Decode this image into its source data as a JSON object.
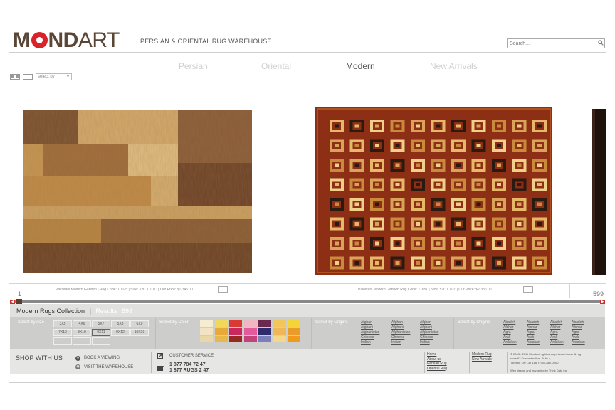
{
  "header": {
    "logo_bold": "MOND",
    "logo_light": "ART",
    "tagline": "PERSIAN & ORIENTAL RUG WAREHOUSE",
    "search_placeholder": "Search..."
  },
  "nav": [
    {
      "label": "Persian",
      "active": false
    },
    {
      "label": "Oriental",
      "active": false
    },
    {
      "label": "Modern",
      "active": true
    },
    {
      "label": "New Arrivals",
      "active": false
    }
  ],
  "select_by": "select by",
  "rugs": [
    {
      "caption": "Pakistani Modern Gabbeh  |  Rug Code: 10025  |  Size: 5'8\" X 7'11\"  |  Our Price: $1,345.00"
    },
    {
      "caption": "Pakistani Modern Gabbeh Rug Code: 11651  |  Size: 5'8\" X 8'0\"  |  Our Price: $2,380.00"
    }
  ],
  "pager": {
    "first": "1",
    "last": "599"
  },
  "collection": {
    "title": "Modern Rugs Collection",
    "results_label": "Results",
    "results_count": "599"
  },
  "filters": {
    "size_label": "Select by size",
    "sizes": [
      "3X5",
      "4X6",
      "5X7",
      "5X8",
      "6X9",
      "7X10",
      "8X10",
      "9X11",
      "9X12",
      "10X19"
    ],
    "selected_size": "9X11",
    "color_label": "Select by Color",
    "colors": [
      [
        "#f5ecd2",
        "#f0d85a",
        "#d93a34",
        "#f0b7c3",
        "#6b2950",
        "#f3c65a",
        "#f3d53a"
      ],
      [
        "#f2e4c2",
        "#e8a93a",
        "#c8285e",
        "#e45b9b",
        "#2d2c6a",
        "#f0b65a",
        "#ea9c2a"
      ],
      [
        "#e9d7a8",
        "#e8b84a",
        "#962a23",
        "#c2437a",
        "#7a7fba",
        "#f3d78a",
        "#f29a1e"
      ]
    ],
    "origins_label": "Select by Origins",
    "origins_col": [
      "Afghan",
      "Afghani",
      "Afghanistan",
      "Chinese",
      "Indian"
    ],
    "origins2_label": "Select by Origins",
    "origins2_col": [
      "Abadeh",
      "Afshar",
      "Agra",
      "Arak",
      "Ardakan"
    ]
  },
  "footer": {
    "shop_title": "SHOP WITH US",
    "book": "BOOK A VIEWING",
    "visit": "VISIT THE WAREHOUSE",
    "service": "CUSTOMER SERVICE",
    "phone1": "1 877 784 72 47",
    "phone2": "1 877 RUGS 2 47",
    "links1": [
      "Home",
      "About us",
      "Persian Rug",
      "Oriental Rug"
    ],
    "links2": [
      "Modern Rug",
      "New Arrivals"
    ],
    "copyright": [
      "© 2003 - 2011 MondArt - global carpet warehouse & rug",
      "store 63 Doncaster Ave. Suite 4,",
      "Toronto, ON L3T 1L6 T: 905-882-0000",
      "Web design and marketing by Think Data Inc"
    ]
  },
  "colors": {
    "accent": "#d8232a",
    "brand": "#5a4636"
  }
}
